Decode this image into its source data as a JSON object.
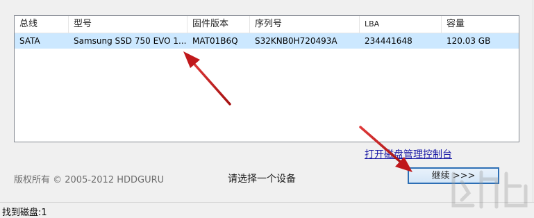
{
  "table": {
    "columns": [
      "总线",
      "型号",
      "固件版本",
      "序列号",
      "LBA",
      "容量"
    ],
    "rows": [
      [
        "SATA",
        "Samsung SSD 750 EVO 1...",
        "MAT01B6Q",
        "S32KNB0H720493A",
        "234441648",
        "120.03 GB"
      ]
    ]
  },
  "console_link": "打开磁盘管理控制台",
  "copyright": "版权所有 © 2005-2012 HDDGURU",
  "prompt": "请选择一个设备",
  "continue_button": "继续 >>>",
  "status": "找到磁盘:1",
  "colors": {
    "selection": "#cce8ff",
    "link": "#1a1aa6",
    "button_border": "#2d6fb5",
    "arrow": "#c0181b"
  },
  "icons": [
    "red-arrow-icon",
    "watermark-logo"
  ]
}
